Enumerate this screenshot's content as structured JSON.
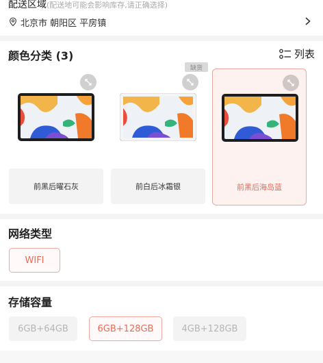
{
  "region": {
    "title": "配送区域",
    "hint": "(配送地可能会影响库存,请正确选择)",
    "address": "北京市 朝阳区 平房镇"
  },
  "color_section": {
    "title": "颜色分类 (3)",
    "list_label": "列表",
    "badge": "缺货",
    "options": [
      {
        "label": "前黑后曜石灰",
        "selected": false
      },
      {
        "label": "前白后冰霜银",
        "selected": false
      },
      {
        "label": "前黑后海岛蓝",
        "selected": true
      }
    ]
  },
  "network_section": {
    "title": "网络类型",
    "options": [
      {
        "label": "WIFI",
        "selected": true
      }
    ]
  },
  "storage_section": {
    "title": "存储容量",
    "options": [
      {
        "label": "6GB+64GB",
        "selected": false
      },
      {
        "label": "6GB+128GB",
        "selected": true
      },
      {
        "label": "4GB+128GB",
        "selected": false
      }
    ]
  },
  "colors": {
    "accent": "#e86a55",
    "accent_border": "#e8a9a0"
  }
}
